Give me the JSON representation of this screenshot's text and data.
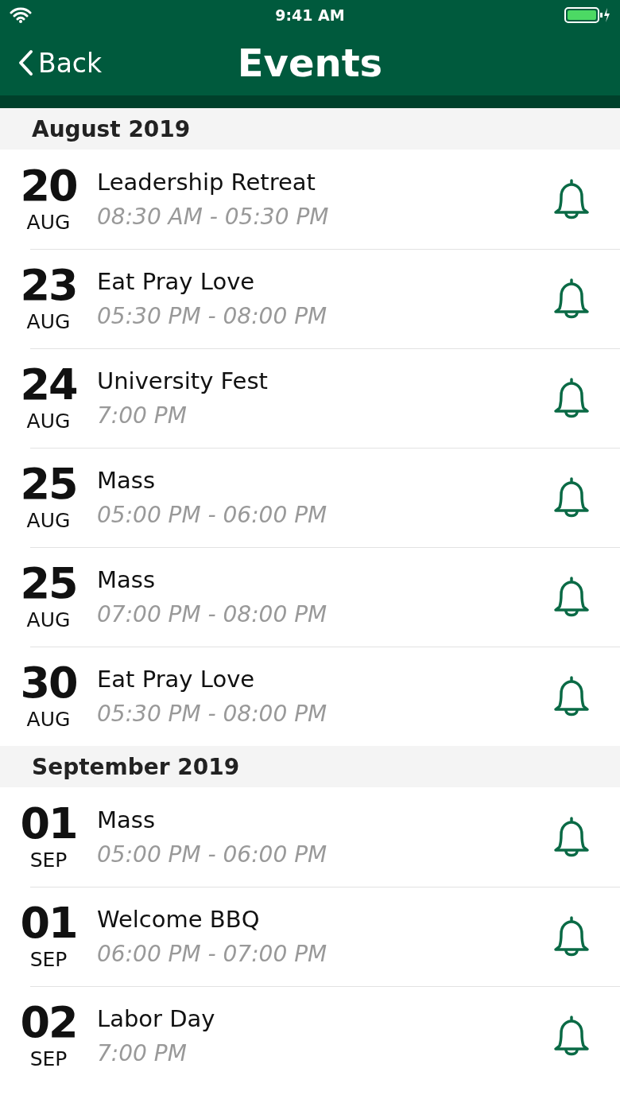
{
  "status_bar": {
    "time": "9:41 AM"
  },
  "nav": {
    "back": "Back",
    "title": "Events"
  },
  "sections": [
    {
      "title": "August 2019",
      "events": [
        {
          "day": "20",
          "month": "AUG",
          "title": "Leadership Retreat",
          "time": "08:30 AM - 05:30 PM"
        },
        {
          "day": "23",
          "month": "AUG",
          "title": "Eat Pray Love",
          "time": "05:30 PM - 08:00 PM"
        },
        {
          "day": "24",
          "month": "AUG",
          "title": "University Fest",
          "time": "7:00 PM"
        },
        {
          "day": "25",
          "month": "AUG",
          "title": "Mass",
          "time": "05:00 PM - 06:00 PM"
        },
        {
          "day": "25",
          "month": "AUG",
          "title": "Mass",
          "time": "07:00 PM - 08:00 PM"
        },
        {
          "day": "30",
          "month": "AUG",
          "title": "Eat Pray Love",
          "time": "05:30 PM - 08:00 PM"
        }
      ]
    },
    {
      "title": "September 2019",
      "events": [
        {
          "day": "01",
          "month": "SEP",
          "title": "Mass",
          "time": "05:00 PM - 06:00 PM"
        },
        {
          "day": "01",
          "month": "SEP",
          "title": "Welcome BBQ",
          "time": "06:00 PM - 07:00 PM"
        },
        {
          "day": "02",
          "month": "SEP",
          "title": "Labor Day",
          "time": "7:00 PM"
        }
      ]
    }
  ]
}
